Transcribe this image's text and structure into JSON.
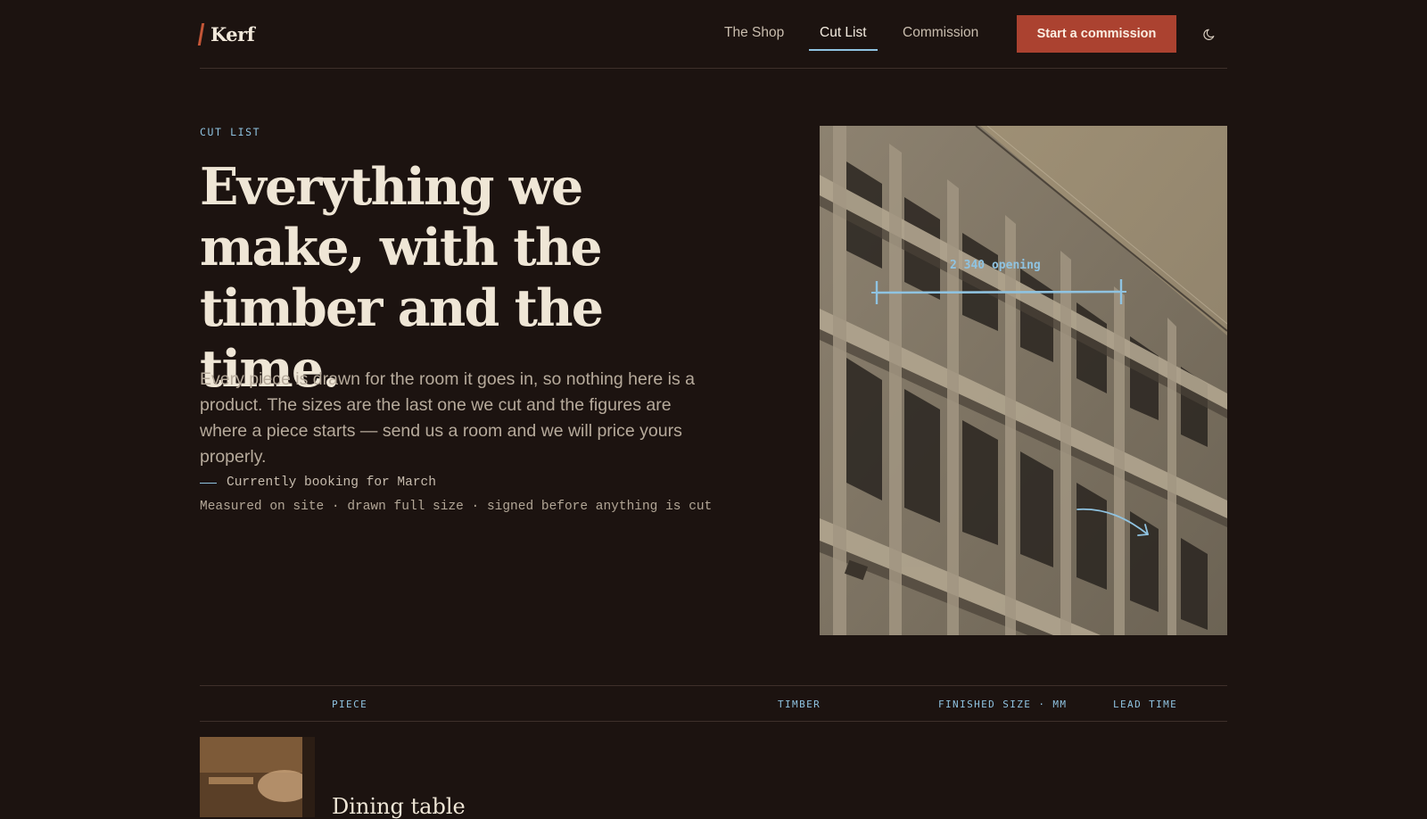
{
  "brand": {
    "name": "Kerf"
  },
  "nav": {
    "items": [
      {
        "label": "The Shop",
        "active": false
      },
      {
        "label": "Cut List",
        "active": true
      },
      {
        "label": "Commission",
        "active": false
      }
    ],
    "cta_label": "Start a commission",
    "theme_toggle_icon": "moon-icon"
  },
  "hero": {
    "eyebrow": "CUT LIST",
    "headline_lines": [
      "Everything we",
      "make, with the",
      "timber and the time."
    ],
    "lede": "Every piece is drawn for the room it goes in, so nothing here is a product. The sizes are the last one we cut and the figures are where a piece starts — send us a room and we will price yours properly.",
    "booking": "Currently booking for March",
    "process": "Measured on site · drawn full size · signed before anything is cut"
  },
  "photo": {
    "dimension_label": "2 340 opening",
    "annotation_icon": "arrow-icon"
  },
  "table": {
    "headers": [
      "PIECE",
      "TIMBER",
      "FINISHED SIZE · MM",
      "LEAD TIME"
    ],
    "rows": [
      {
        "title": "Dining table"
      }
    ]
  },
  "colors": {
    "background": "#1c1310",
    "accent_red": "#ab4230",
    "accent_blue": "#8fc3e1",
    "text": "#efe6d6"
  }
}
